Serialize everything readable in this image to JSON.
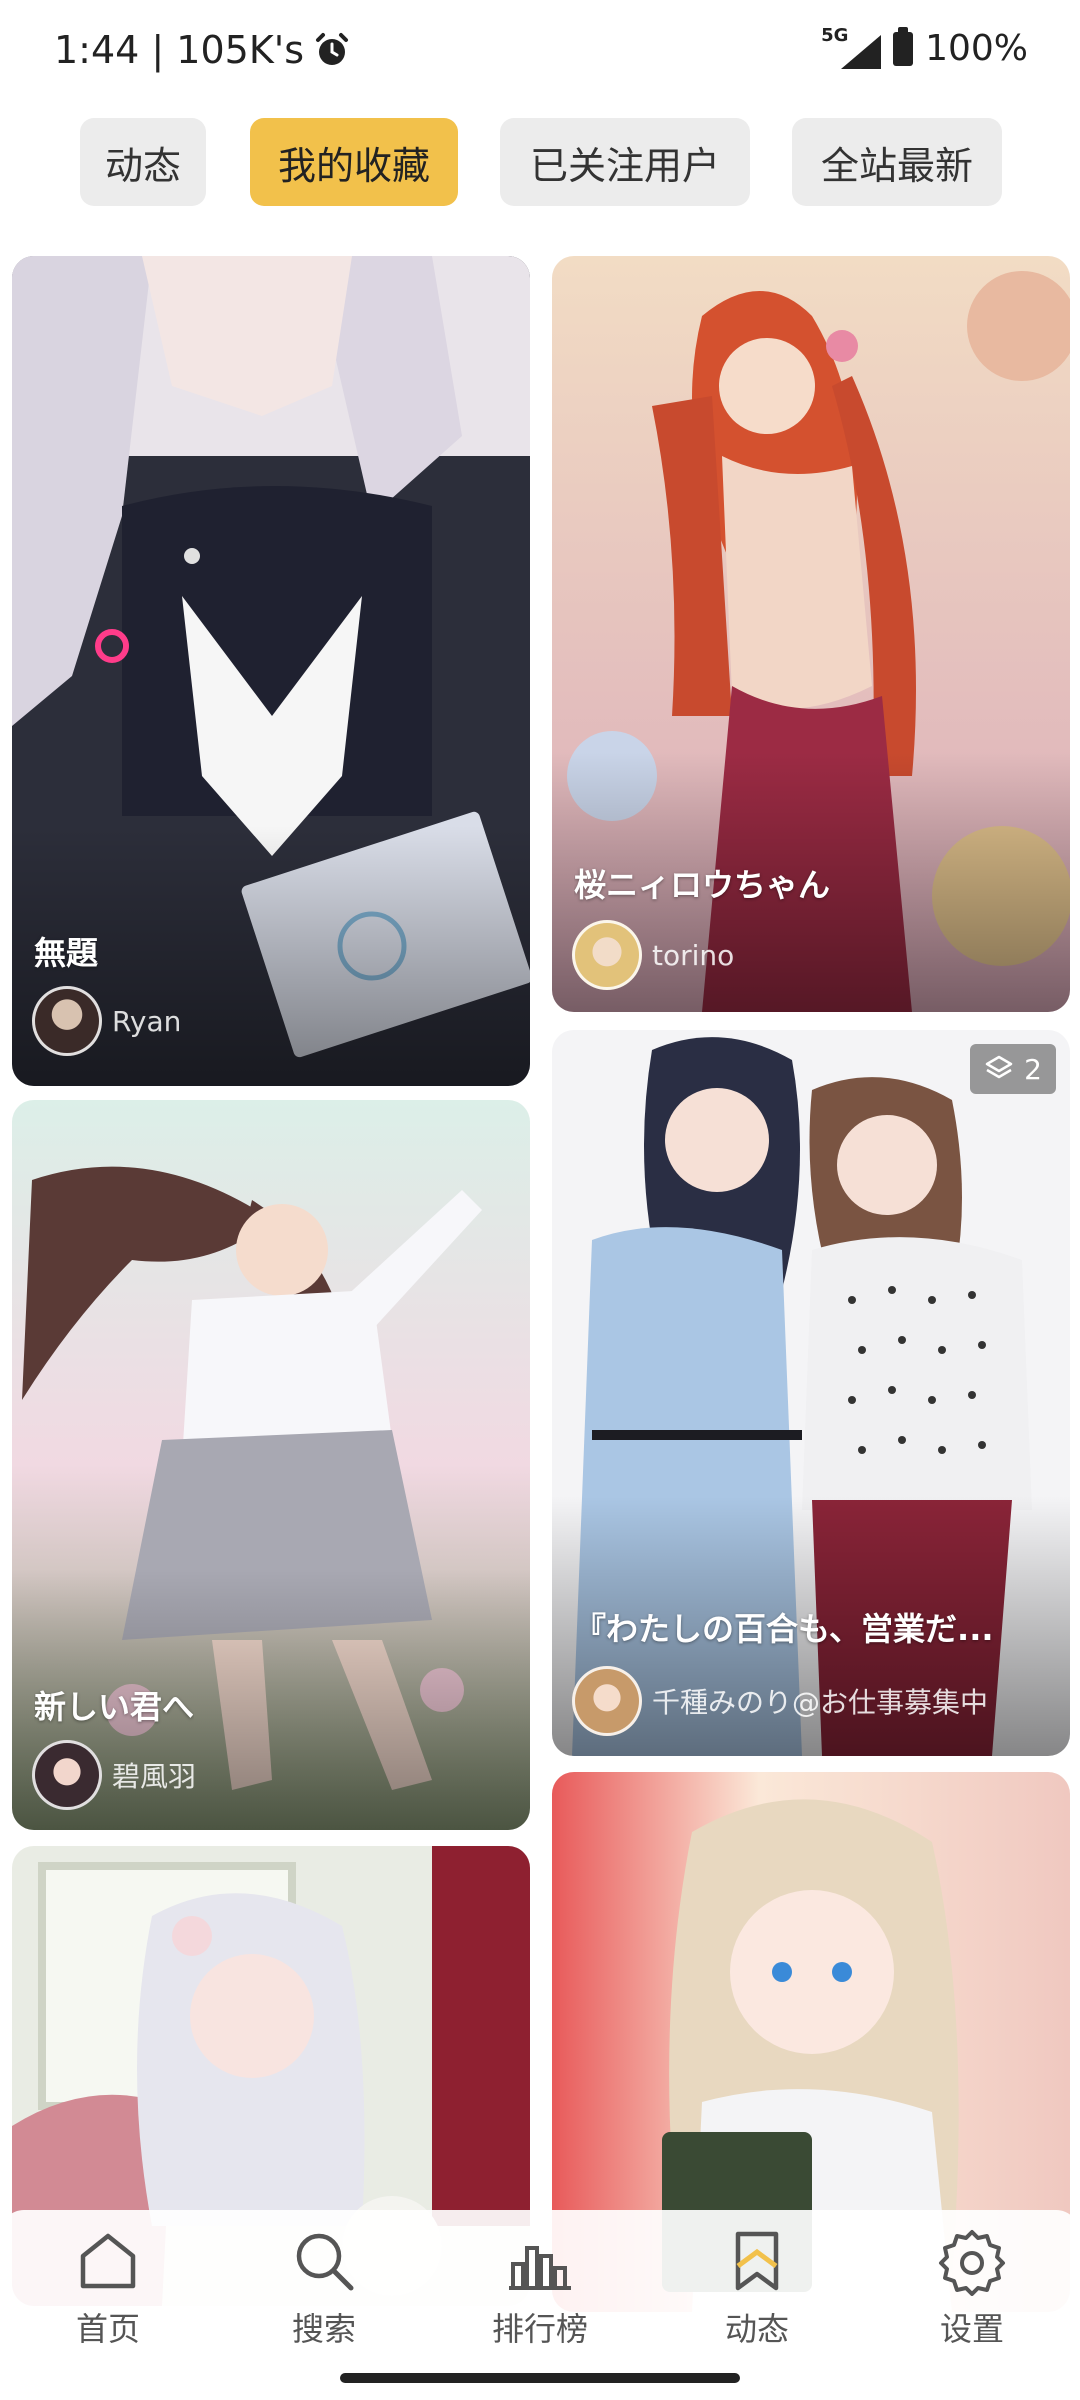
{
  "status_bar": {
    "time_label": "1:44 | 105K's",
    "network": "5G",
    "battery": "100%"
  },
  "tabs": [
    {
      "label": "动态",
      "active": false
    },
    {
      "label": "我的收藏",
      "active": true
    },
    {
      "label": "已关注用户",
      "active": false
    },
    {
      "label": "全站最新",
      "active": false
    }
  ],
  "cards": [
    {
      "title": "無題",
      "author": "Ryan"
    },
    {
      "title": "桜ニィロウちゃん",
      "author": "torino"
    },
    {
      "title": "新しい君へ",
      "author": "碧風羽"
    },
    {
      "title": "『わたしの百合も、営業だ...",
      "author": "千種みのり@お仕事募集中",
      "page_count": "2"
    },
    {
      "title": "",
      "author": ""
    },
    {
      "title": "",
      "author": ""
    }
  ],
  "bottom_nav": [
    {
      "label": "首页",
      "icon": "home-icon"
    },
    {
      "label": "搜索",
      "icon": "search-icon"
    },
    {
      "label": "排行榜",
      "icon": "ranking-icon"
    },
    {
      "label": "动态",
      "icon": "bookmark-icon"
    },
    {
      "label": "设置",
      "icon": "settings-icon"
    }
  ],
  "colors": {
    "accent": "#f2c14b",
    "tab_inactive": "#ececec"
  }
}
